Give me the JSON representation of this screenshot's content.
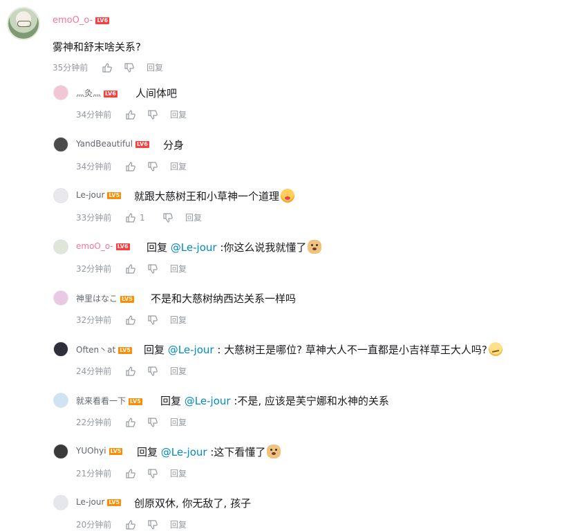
{
  "main_comment": {
    "username": "emoO_o-",
    "level": "LV6",
    "text": "雾神和舒末啥关系?",
    "time": "35分钟前",
    "reply_label": "回复"
  },
  "replies": [
    {
      "username": "灬灸灬",
      "level": "LV6",
      "text": "人间体吧",
      "time": "34分钟前",
      "likes": "",
      "reply_label": "回复"
    },
    {
      "username": "YandBeautiful",
      "level": "LV6",
      "text": "分身",
      "time": "34分钟前",
      "likes": "",
      "reply_label": "回复"
    },
    {
      "username": "Le-jour",
      "level": "LV5",
      "text": "就跟大慈树王和小草神一个道理",
      "emoji": "kiss-emoji",
      "time": "33分钟前",
      "likes": "1",
      "reply_label": "回复"
    },
    {
      "username": "emoO_o-",
      "level": "LV6",
      "prefix": "回复",
      "mention": "@Le-jour",
      "text": ":你这么说我就懂了",
      "emoji": "doge-emoji",
      "time": "32分钟前",
      "likes": "",
      "reply_label": "回复"
    },
    {
      "username": "神里はなこ",
      "level": "LV5",
      "text": "不是和大慈树纳西达关系一样吗",
      "time": "32分钟前",
      "likes": "",
      "reply_label": "回复"
    },
    {
      "username": "Often丶at",
      "level": "LV5",
      "prefix": "回复",
      "mention": "@Le-jour",
      "text": ": 大慈树王是哪位? 草神大人不一直都是小吉祥草王大人吗?",
      "emoji": "thinking-emoji",
      "time": "24分钟前",
      "likes": "",
      "reply_label": "回复"
    },
    {
      "username": "就来看看一下",
      "level": "LV5",
      "prefix": "回复",
      "mention": "@Le-jour",
      "text": ":不是, 应该是芙宁娜和水神的关系",
      "time": "22分钟前",
      "likes": "",
      "reply_label": "回复"
    },
    {
      "username": "YUOhyi",
      "level": "LV5",
      "prefix": "回复",
      "mention": "@Le-jour",
      "text": ":这下看懂了",
      "emoji": "doge-emoji",
      "time": "21分钟前",
      "likes": "",
      "reply_label": "回复"
    },
    {
      "username": "Le-jour",
      "level": "LV5",
      "text": "创原双休, 你无敌了, 孩子",
      "time": "20分钟前",
      "likes": "",
      "reply_label": "回复"
    }
  ],
  "colors": {
    "vip_name": "#fb7299",
    "mention": "#008ac5",
    "lv6": "#ff3b3b",
    "lv5": "#ff8c00",
    "meta": "#9499a0"
  }
}
